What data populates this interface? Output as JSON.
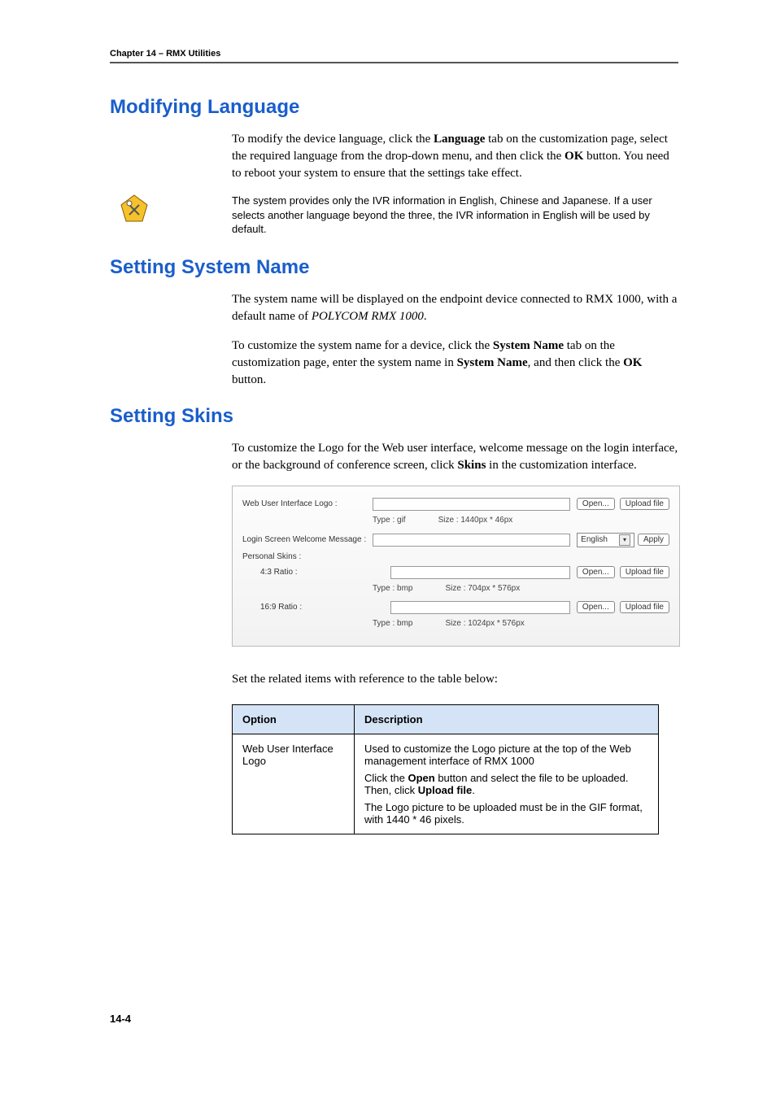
{
  "header": {
    "chapter": "Chapter 14 – RMX Utilities"
  },
  "sections": {
    "lang": {
      "title": "Modifying Language",
      "para_pre": "To modify the device language, click the ",
      "para_b1": "Language",
      "para_mid": " tab on the customization page, select the required language from the drop-down menu, and then click the ",
      "para_b2": "OK",
      "para_post": " button. You need to reboot your system to ensure that the settings take effect.",
      "note": "The system provides only the IVR information in English, Chinese and Japanese. If a user selects another language beyond the three, the IVR information in English will be used by default."
    },
    "sysname": {
      "title": "Setting System Name",
      "p1_pre": "The system name will be displayed on the endpoint device connected to RMX 1000, with a default name of ",
      "p1_i": "POLYCOM RMX 1000",
      "p1_post": ".",
      "p2_pre": "To customize the system name for a device, click the ",
      "p2_b1": "System Name",
      "p2_mid": " tab on the customization page, enter the system name in ",
      "p2_b2": "System Name",
      "p2_mid2": ", and then click the ",
      "p2_b3": "OK",
      "p2_post": " button."
    },
    "skins": {
      "title": "Setting Skins",
      "p1_pre": "To customize the Logo for the Web user interface, welcome message on the login interface, or the background of conference screen, click ",
      "p1_b": "Skins",
      "p1_post": " in the customization interface.",
      "panel": {
        "webLogoLabel": "Web User Interface Logo :",
        "open": "Open...",
        "upload": "Upload file",
        "type_gif": "Type : gif",
        "size1": "Size : 1440px * 46px",
        "loginMsgLabel": "Login Screen Welcome Message :",
        "english": "English",
        "apply": "Apply",
        "personal": "Personal Skins :",
        "ratio43": "4:3 Ratio :",
        "type_bmp": "Type : bmp",
        "size2": "Size : 704px * 576px",
        "ratio169": "16:9 Ratio :",
        "size3": "Size : 1024px * 576px"
      },
      "tableIntro": "Set the related items with reference to the table below:",
      "table": {
        "h1": "Option",
        "h2": "Description",
        "rowLabel": "Web User Interface Logo",
        "d_line1": "Used to customize the Logo picture at the top of the Web management interface of RMX 1000",
        "d_line2_pre": "Click the ",
        "d_line2_b1": "Open",
        "d_line2_mid": " button and select the file to be uploaded. Then, click ",
        "d_line2_b2": "Upload file",
        "d_line2_post": ".",
        "d_line3": "The Logo picture to be uploaded must be in the GIF format, with 1440 * 46 pixels."
      }
    }
  },
  "pageNum": "14-4"
}
